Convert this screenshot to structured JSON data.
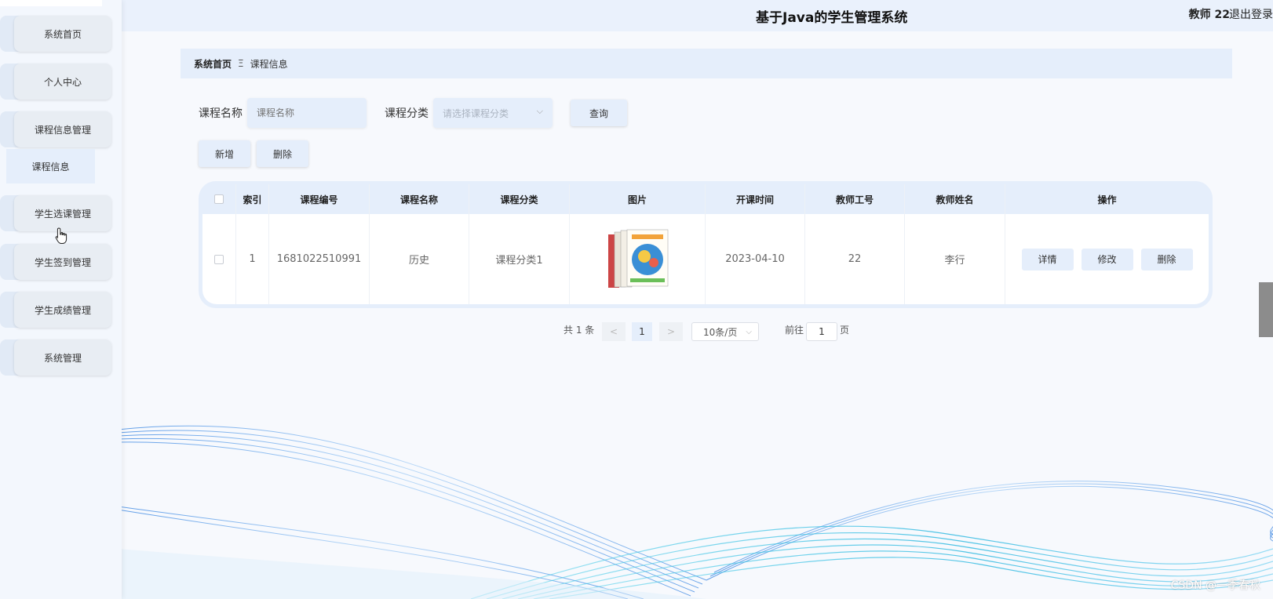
{
  "header": {
    "title": "基于Java的学生管理系统",
    "user": "教师 22",
    "logout": "退出登录"
  },
  "sidebar": {
    "items": [
      {
        "label": "系统首页"
      },
      {
        "label": "个人中心"
      },
      {
        "label": "课程信息管理"
      },
      {
        "label": "学生选课管理"
      },
      {
        "label": "学生签到管理"
      },
      {
        "label": "学生成绩管理"
      },
      {
        "label": "系统管理"
      }
    ],
    "submenu": {
      "label": "课程信息"
    }
  },
  "breadcrumb": {
    "home": "系统首页",
    "separator": "Ξ",
    "current": "课程信息"
  },
  "search": {
    "name_label": "课程名称",
    "name_placeholder": "课程名称",
    "category_label": "课程分类",
    "category_placeholder": "请选择课程分类",
    "query_button": "查询"
  },
  "actions": {
    "add": "新增",
    "delete": "删除"
  },
  "table": {
    "columns": [
      "索引",
      "课程编号",
      "课程名称",
      "课程分类",
      "图片",
      "开课时间",
      "教师工号",
      "教师姓名",
      "操作"
    ],
    "rows": [
      {
        "index": "1",
        "course_no": "1681022510991",
        "course_name": "历史",
        "category": "课程分类1",
        "start_date": "2023-04-10",
        "teacher_no": "22",
        "teacher_name": "李行",
        "ops": [
          "详情",
          "修改",
          "删除"
        ]
      }
    ]
  },
  "pagination": {
    "total": "共 1 条",
    "prev": "<",
    "page": "1",
    "next": ">",
    "page_size": "10条/页",
    "goto_prefix": "前往",
    "goto_value": "1",
    "goto_suffix": "页"
  },
  "watermark": "CSDN @一季春秋",
  "colors": {
    "accent_bg": "#e5eefb",
    "header_bg": "#eaf1fc",
    "wave_blue": "#4a90e2",
    "wave_cyan": "#3cc8e6"
  }
}
